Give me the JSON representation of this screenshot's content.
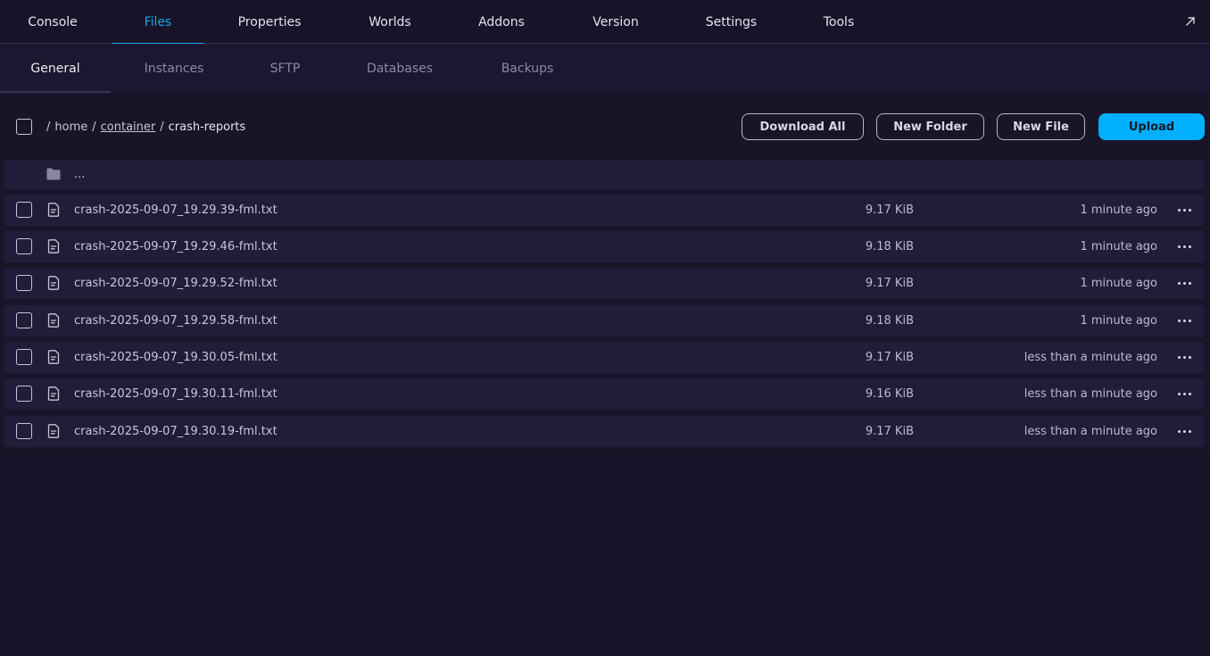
{
  "top_tabs": [
    {
      "label": "Console"
    },
    {
      "label": "Files"
    },
    {
      "label": "Properties"
    },
    {
      "label": "Worlds"
    },
    {
      "label": "Addons"
    },
    {
      "label": "Version"
    },
    {
      "label": "Settings"
    },
    {
      "label": "Tools"
    }
  ],
  "sub_tabs": [
    {
      "label": "General"
    },
    {
      "label": "Instances"
    },
    {
      "label": "SFTP"
    },
    {
      "label": "Databases"
    },
    {
      "label": "Backups"
    }
  ],
  "breadcrumb": {
    "sep1": "/",
    "home": "home",
    "sep2": "/",
    "container": "container",
    "sep3": "/",
    "current": "crash-reports"
  },
  "buttons": {
    "download_all": "Download All",
    "new_folder": "New Folder",
    "new_file": "New File",
    "upload": "Upload"
  },
  "up_dir": "...",
  "files": [
    {
      "name": "crash-2025-09-07_19.29.39-fml.txt",
      "size": "9.17 KiB",
      "modified": "1 minute ago"
    },
    {
      "name": "crash-2025-09-07_19.29.46-fml.txt",
      "size": "9.18 KiB",
      "modified": "1 minute ago"
    },
    {
      "name": "crash-2025-09-07_19.29.52-fml.txt",
      "size": "9.17 KiB",
      "modified": "1 minute ago"
    },
    {
      "name": "crash-2025-09-07_19.29.58-fml.txt",
      "size": "9.18 KiB",
      "modified": "1 minute ago"
    },
    {
      "name": "crash-2025-09-07_19.30.05-fml.txt",
      "size": "9.17 KiB",
      "modified": "less than a minute ago"
    },
    {
      "name": "crash-2025-09-07_19.30.11-fml.txt",
      "size": "9.16 KiB",
      "modified": "less than a minute ago"
    },
    {
      "name": "crash-2025-09-07_19.30.19-fml.txt",
      "size": "9.17 KiB",
      "modified": "less than a minute ago"
    }
  ],
  "colors": {
    "accent": "#19a7ee",
    "upload": "#00b0ff",
    "background": "#181328",
    "row": "#221c38"
  }
}
